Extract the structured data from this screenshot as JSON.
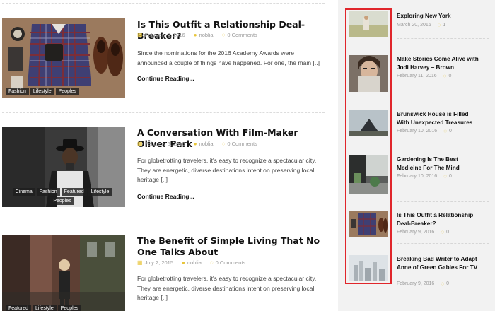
{
  "posts": [
    {
      "title": "Is This Outfit a Relationship Deal-Breaker?",
      "date": "February 9, 2016",
      "author": "noblia",
      "comments": "0 Comments",
      "excerpt": "Since the nominations for the 2016 Academy Awards were announced a couple of things have happened. For one, the main [..]",
      "read_more": "Continue Reading...",
      "tags": [
        "Fashion",
        "Lifestyle",
        "Peoples"
      ]
    },
    {
      "title": "A Conversation With Film-Maker Oliver Park",
      "date": "February 6, 2016",
      "author": "noblia",
      "comments": "0 Comments",
      "excerpt": "For globetrotting travelers, it's easy to recognize a spectacular city. They are energetic, diverse destinations intent on preserving local heritage [..]",
      "read_more": "Continue Reading...",
      "tags": [
        "Cinema",
        "Fashion",
        "Featured",
        "Lifestyle",
        "Peoples"
      ]
    },
    {
      "title": "The Benefit of Simple Living That No One Talks About",
      "date": "July 2, 2015",
      "author": "noblia",
      "comments": "0 Comments",
      "excerpt": "For globetrotting travelers, it's easy to recognize a spectacular city. They are energetic, diverse destinations intent on preserving local heritage [..]",
      "tags": [
        "Featured",
        "Lifestyle",
        "Peoples"
      ]
    }
  ],
  "sidebar": [
    {
      "title": "Exploring New York",
      "date": "March 20, 2016",
      "comments": "1"
    },
    {
      "title": "Make Stories Come Alive with Jodi Harvey – Brown",
      "date": "February 11, 2016",
      "comments": "0"
    },
    {
      "title": "Brunswick House is Filled With Unexpected Treasures",
      "date": "February 10, 2016",
      "comments": "0"
    },
    {
      "title": "Gardening Is The Best Medicine For The Mind",
      "date": "February 10, 2016",
      "comments": "0"
    },
    {
      "title": "Is This Outfit a Relationship Deal-Breaker?",
      "date": "February 9, 2016",
      "comments": "0"
    },
    {
      "title": "Breaking Bad Writer to Adapt Anne of Green Gables For TV",
      "date": "February 9, 2016",
      "comments": "0"
    }
  ],
  "icons": {
    "calendar": "calendar-icon",
    "author": "user-icon",
    "comments": "comment-icon"
  },
  "colors": {
    "accent": "#e8c53a",
    "highlight": "#e0262b"
  }
}
